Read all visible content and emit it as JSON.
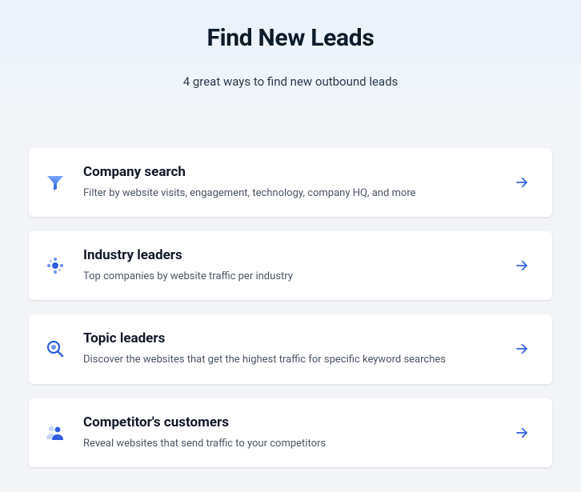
{
  "hero": {
    "title": "Find New Leads",
    "subtitle": "4 great ways to find new outbound leads"
  },
  "cards": [
    {
      "icon": "funnel-icon",
      "title": "Company search",
      "description": "Filter by website visits, engagement, technology, company HQ, and more"
    },
    {
      "icon": "molecule-icon",
      "title": "Industry leaders",
      "description": "Top companies by website traffic per industry"
    },
    {
      "icon": "magnify-icon",
      "title": "Topic leaders",
      "description": "Discover the websites that get the highest traffic for specific keyword searches"
    },
    {
      "icon": "people-icon",
      "title": "Competitor's customers",
      "description": "Reveal websites that send traffic to your competitors"
    }
  ],
  "colors": {
    "accent": "#2f5fe0"
  }
}
